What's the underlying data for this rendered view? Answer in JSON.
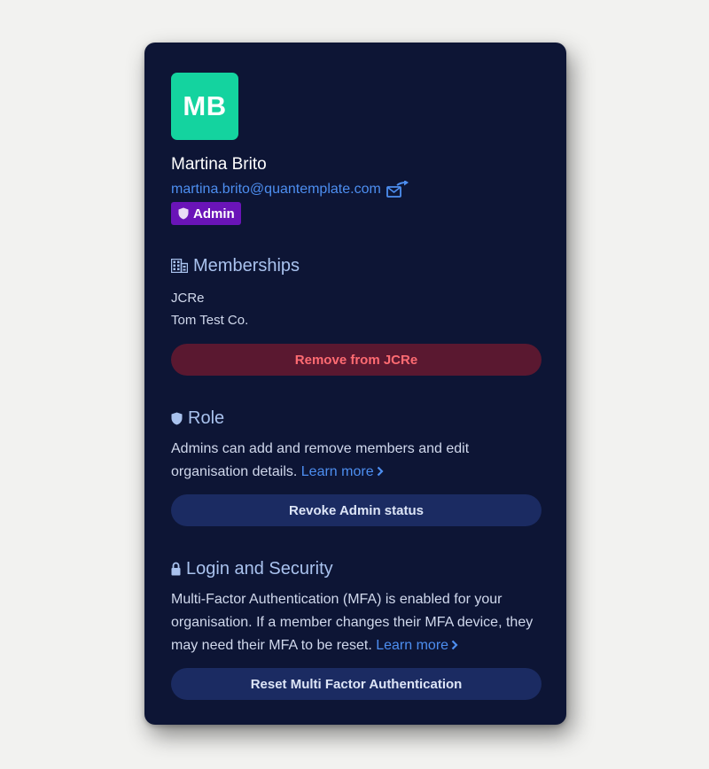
{
  "user": {
    "initials": "MB",
    "name": "Martina Brito",
    "email": "martina.brito@quantemplate.com",
    "badge_label": "Admin"
  },
  "memberships": {
    "title": "Memberships",
    "items": [
      "JCRe",
      "Tom Test Co."
    ],
    "remove_button_label": "Remove from JCRe"
  },
  "role": {
    "title": "Role",
    "description": "Admins can add and remove members and edit organisation details.",
    "learn_more_label": "Learn more",
    "revoke_button_label": "Revoke Admin status"
  },
  "security": {
    "title": "Login and Security",
    "description": "Multi-Factor Authentication (MFA) is enabled for your organisation. If a member changes their MFA device, they may need their MFA to be reset.",
    "learn_more_label": "Learn more",
    "reset_button_label": "Reset Multi Factor Authentication"
  },
  "colors": {
    "card_background": "#0d1535",
    "avatar": "#14d39f",
    "link": "#4d8ef0",
    "admin_badge": "#6a14b8",
    "danger_button": "#5a1830",
    "danger_text": "#ff6b72",
    "neutral_button": "#1b2b62"
  },
  "icons": {
    "email": "send-email-icon",
    "badge": "shield-icon",
    "memberships": "building-icon",
    "role": "shield-icon",
    "security": "lock-icon",
    "learn_more": "chevron-right-icon"
  }
}
